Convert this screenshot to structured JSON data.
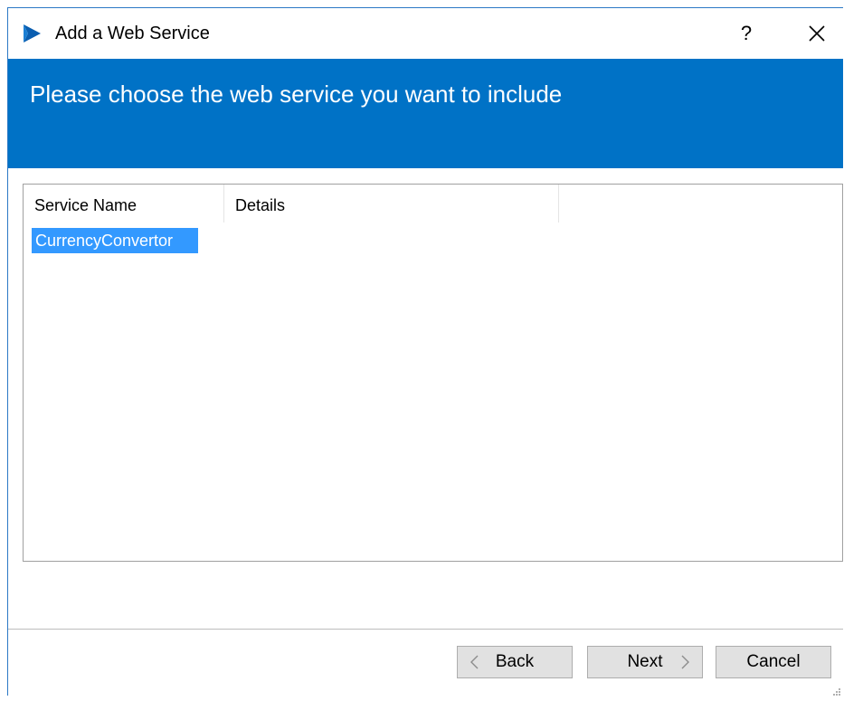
{
  "window": {
    "title": "Add a Web Service",
    "help_label": "?"
  },
  "banner": {
    "text": "Please choose the web service you want to include"
  },
  "list": {
    "columns": [
      "Service Name",
      "Details"
    ],
    "rows": [
      {
        "service_name": "CurrencyConvertor",
        "details": "",
        "selected": true
      }
    ]
  },
  "footer": {
    "back_label": "Back",
    "next_label": "Next",
    "cancel_label": "Cancel"
  },
  "colors": {
    "banner": "#0072c6",
    "selection": "#3399ff",
    "app_icon": "#0a5eb0"
  },
  "icons": {
    "app": "app-logo-icon",
    "close": "close-icon",
    "back": "chevron-left-icon",
    "next": "chevron-right-icon"
  }
}
